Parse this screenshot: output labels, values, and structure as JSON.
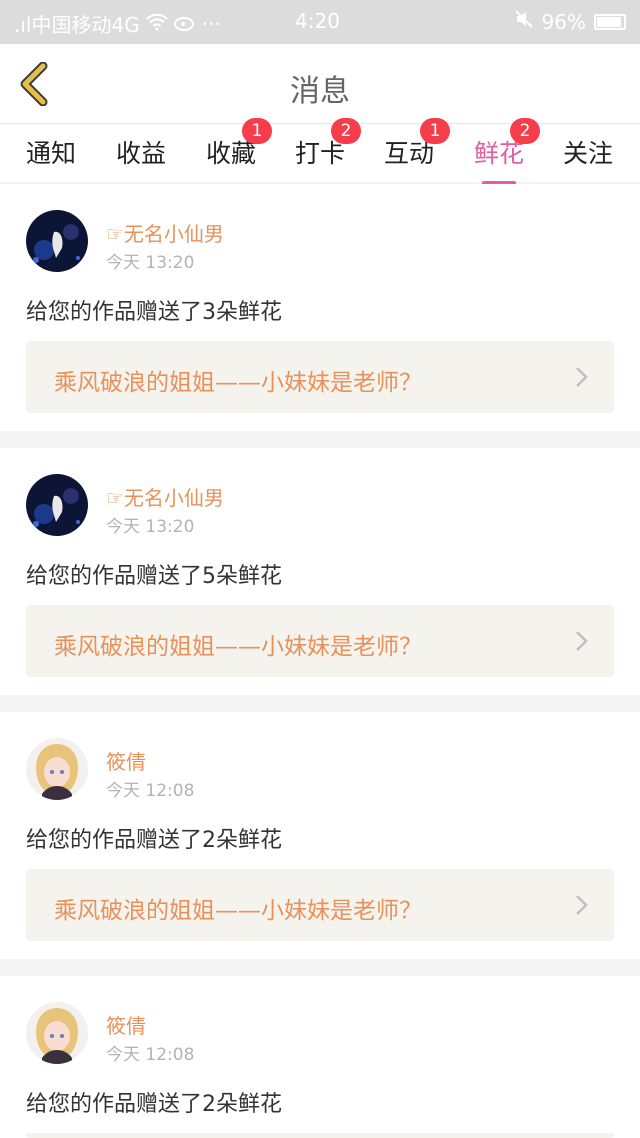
{
  "status_bar": {
    "carrier": ".ıl中国移动4G",
    "time": "4:20",
    "battery": "96%"
  },
  "header": {
    "title": "消息",
    "back_icon": "chevron-left-icon"
  },
  "tabs": [
    {
      "label": "通知",
      "badge": ""
    },
    {
      "label": "收益",
      "badge": ""
    },
    {
      "label": "收藏",
      "badge": "1"
    },
    {
      "label": "打卡",
      "badge": "2"
    },
    {
      "label": "互动",
      "badge": "1"
    },
    {
      "label": "鲜花",
      "badge": "2"
    },
    {
      "label": "关注",
      "badge": ""
    }
  ],
  "active_tab": "鲜花",
  "colors": {
    "accent": "#e45da0",
    "name": "#e9915a",
    "badge": "#f53d4b",
    "back": "#e6c14a"
  },
  "messages": [
    {
      "user": "☞无名小仙男",
      "time": "今天 13:20",
      "text": "给您的作品赠送了3朵鲜花",
      "work_title": "乘风破浪的姐姐——小妹妹是老师？"
    },
    {
      "user": "☞无名小仙男",
      "time": "今天 13:20",
      "text": "给您的作品赠送了5朵鲜花",
      "work_title": "乘风破浪的姐姐——小妹妹是老师？"
    },
    {
      "user": "筱倩",
      "time": "今天 12:08",
      "text": "给您的作品赠送了2朵鲜花",
      "work_title": "乘风破浪的姐姐——小妹妹是老师？"
    },
    {
      "user": "筱倩",
      "time": "今天 12:08",
      "text": "给您的作品赠送了2朵鲜花",
      "work_title": ""
    }
  ]
}
